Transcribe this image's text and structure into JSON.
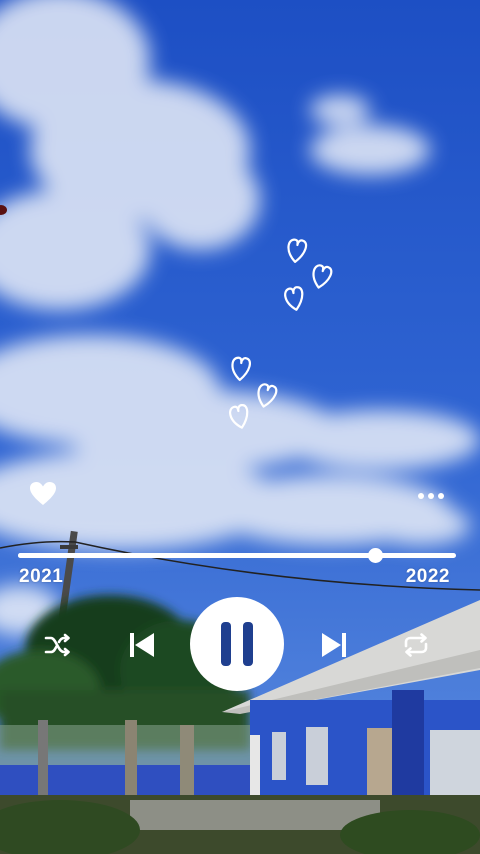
{
  "player": {
    "time_start": "2021",
    "time_end": "2022",
    "progress": 0.815,
    "state": "playing"
  },
  "icons": {
    "like": "heart-icon",
    "more": "more-dots-icon",
    "shuffle": "shuffle-icon",
    "previous": "skip-previous-icon",
    "play_pause": "pause-icon",
    "next": "skip-next-icon",
    "repeat": "repeat-icon"
  },
  "colors": {
    "controls": "#ffffff",
    "pause_glyph": "#1f3f8f"
  }
}
